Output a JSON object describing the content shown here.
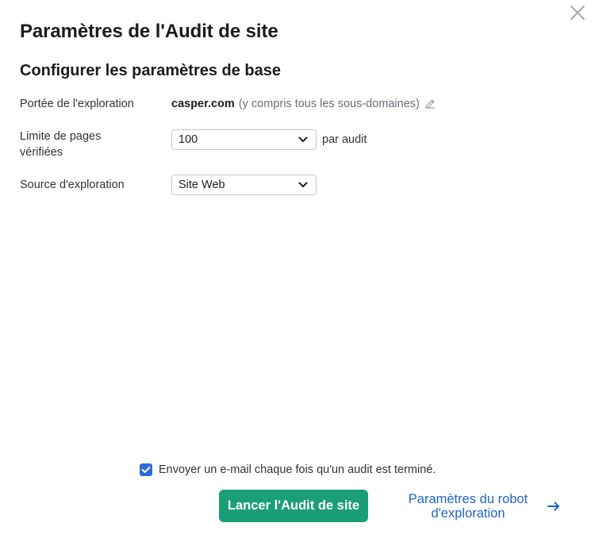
{
  "dialog": {
    "title": "Paramètres de l'Audit de site",
    "section_title": "Configurer les paramètres de base"
  },
  "fields": {
    "scope": {
      "label": "Portée de l'exploration",
      "domain": "casper.com",
      "hint": "(y compris tous les sous-domaines)"
    },
    "page_limit": {
      "label_line1": "Limite de pages",
      "label_line2": "vérifiées",
      "value": "100",
      "suffix": "par audit"
    },
    "crawl_source": {
      "label": "Source d'exploration",
      "value": "Site Web"
    }
  },
  "footer": {
    "email_checkbox_checked": true,
    "email_label": "Envoyer un e-mail chaque fois qu'un audit est terminé.",
    "primary_button": "Lancer l'Audit de site",
    "link_line1": "Paramètres du robot",
    "link_line2": "d'exploration"
  },
  "colors": {
    "primary": "#1a9e78",
    "link": "#1f64c8",
    "checkbox": "#2d6ad8"
  },
  "icons": {
    "close": "close-icon",
    "edit": "pencil-icon",
    "chevron": "chevron-down-icon",
    "check": "check-icon",
    "arrow": "arrow-right-icon"
  }
}
